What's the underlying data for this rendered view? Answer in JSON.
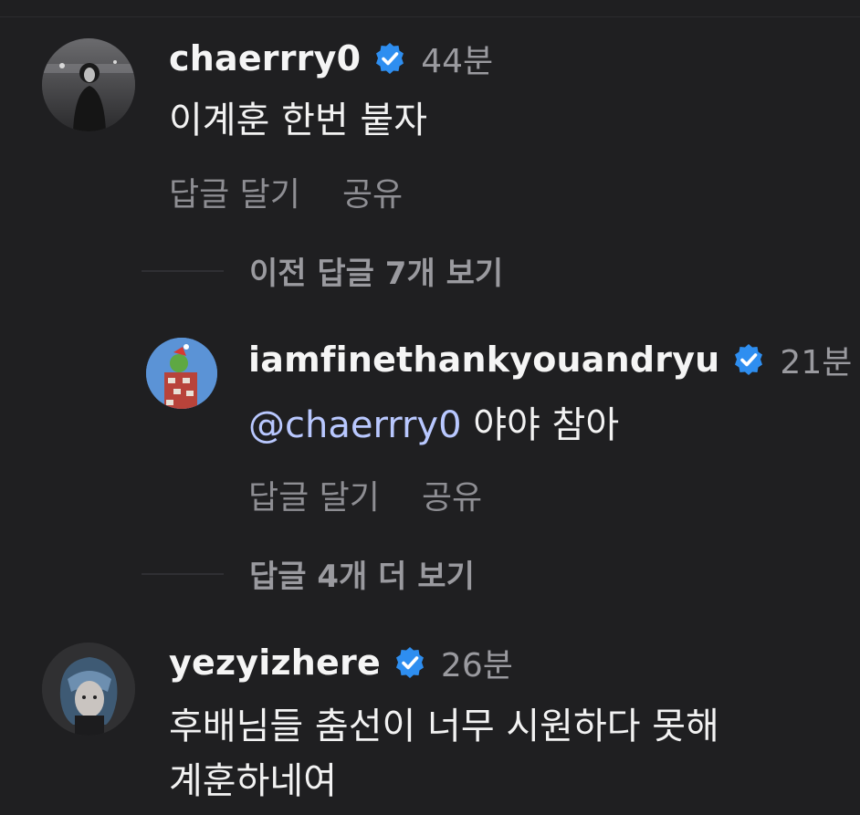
{
  "comments": [
    {
      "username": "chaerrry0",
      "timestamp": "44분",
      "text": "이계훈 한번 붙자",
      "reply_label": "답글 달기",
      "share_label": "공유"
    },
    {
      "username": "iamfinethankyouandryu",
      "timestamp": "21분",
      "mention": "@chaerrry0",
      "text": " 야야 참아",
      "reply_label": "답글 달기",
      "share_label": "공유"
    },
    {
      "username": "yezyizhere",
      "timestamp": "26분",
      "text_line1": "후배님들 춤선이 너무 시원하다 못해",
      "text_line2": "계훈하네여"
    }
  ],
  "view_previous_replies": "이전 답글 7개 보기",
  "view_more_replies": "답글 4개 더 보기",
  "colors": {
    "background": "#1f1f21",
    "verified_badge": "#2e8ef0",
    "mention": "#b9c8ff",
    "muted_text": "#9a9a9f"
  }
}
